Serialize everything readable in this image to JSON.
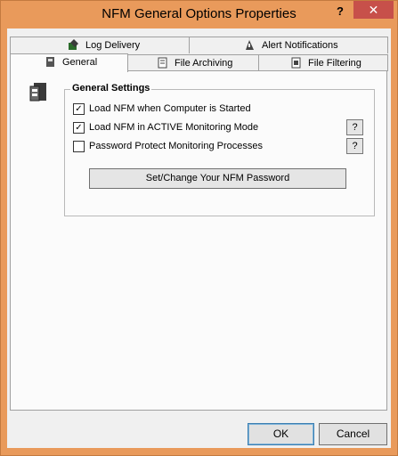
{
  "window": {
    "title": "NFM General Options Properties",
    "help_glyph": "?",
    "close_glyph": "✕"
  },
  "tabs": {
    "row_back": [
      {
        "label": "Log Delivery",
        "icon": "log-delivery-icon"
      },
      {
        "label": "Alert Notifications",
        "icon": "alert-notifications-icon"
      }
    ],
    "row_front": [
      {
        "label": "General",
        "icon": "general-icon",
        "active": true
      },
      {
        "label": "File Archiving",
        "icon": "file-archiving-icon"
      },
      {
        "label": "File Filtering",
        "icon": "file-filtering-icon"
      }
    ]
  },
  "general_settings": {
    "title": "General Settings",
    "options": [
      {
        "label": "Load NFM when Computer is Started",
        "checked": true,
        "mark": "✓",
        "has_help": false
      },
      {
        "label": "Load NFM in ACTIVE Monitoring Mode",
        "checked": true,
        "mark": "✓",
        "has_help": true
      },
      {
        "label": "Password Protect Monitoring Processes",
        "checked": false,
        "mark": "",
        "has_help": true
      }
    ],
    "help_label": "?",
    "password_button": "Set/Change Your NFM Password"
  },
  "footer": {
    "ok": "OK",
    "cancel": "Cancel"
  },
  "colors": {
    "titlebar": "#e99a5b",
    "close": "#c7504a",
    "panel": "#fbfbfb",
    "dialog": "#f0f0f0"
  }
}
